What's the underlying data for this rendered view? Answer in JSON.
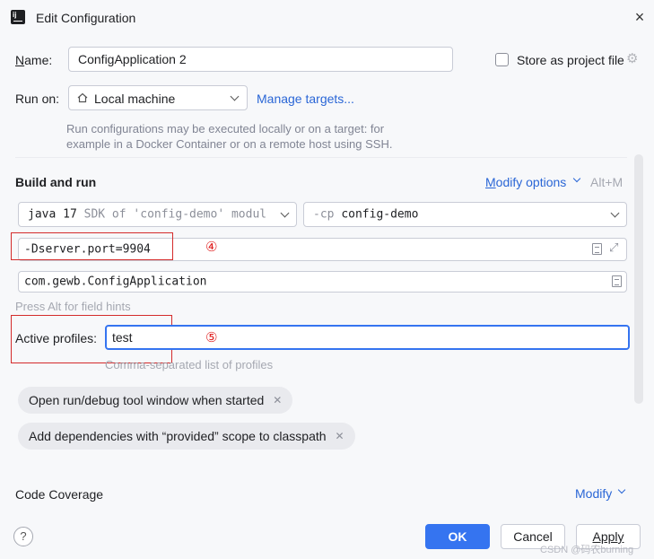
{
  "window": {
    "app_icon": "ij",
    "title": "Edit Configuration",
    "close_icon": "×"
  },
  "name_row": {
    "label": "Name:",
    "value": "ConfigApplication 2",
    "store_label": "Store as project file",
    "store_checked": false
  },
  "run_on": {
    "label": "Run on:",
    "value": "Local machine",
    "manage_link": "Manage targets...",
    "hint": "Run configurations may be executed locally or on a target: for example in a Docker Container or on a remote host using SSH."
  },
  "build_and_run": {
    "heading": "Build and run",
    "modify_options_u": "M",
    "modify_options_rest": "odify options",
    "shortcut": "Alt+M",
    "jdk_main": "java 17",
    "jdk_detail": "SDK of 'config-demo' modul",
    "cp_flag": "-cp",
    "cp_value": "config-demo",
    "vm_options": "-Dserver.port=9904",
    "main_class": "com.gewb.ConfigApplication",
    "field_hint": "Press Alt for field hints"
  },
  "annotations": {
    "marker_4": "④",
    "marker_5": "⑤"
  },
  "profiles": {
    "label": "Active profiles:",
    "value": "test",
    "hint": "Comma-separated list of profiles"
  },
  "chips": [
    {
      "label": "Open run/debug tool window when started"
    },
    {
      "label": "Add dependencies with “provided” scope to classpath"
    }
  ],
  "code_coverage": {
    "label": "Code Coverage",
    "modify": "Modify"
  },
  "footer": {
    "help": "?",
    "ok": "OK",
    "cancel": "Cancel",
    "apply": "Apply",
    "watermark": "CSDN @码农burning"
  },
  "colors": {
    "accent": "#3574f0",
    "link": "#2a66d6",
    "annotation": "#d42b2b"
  }
}
